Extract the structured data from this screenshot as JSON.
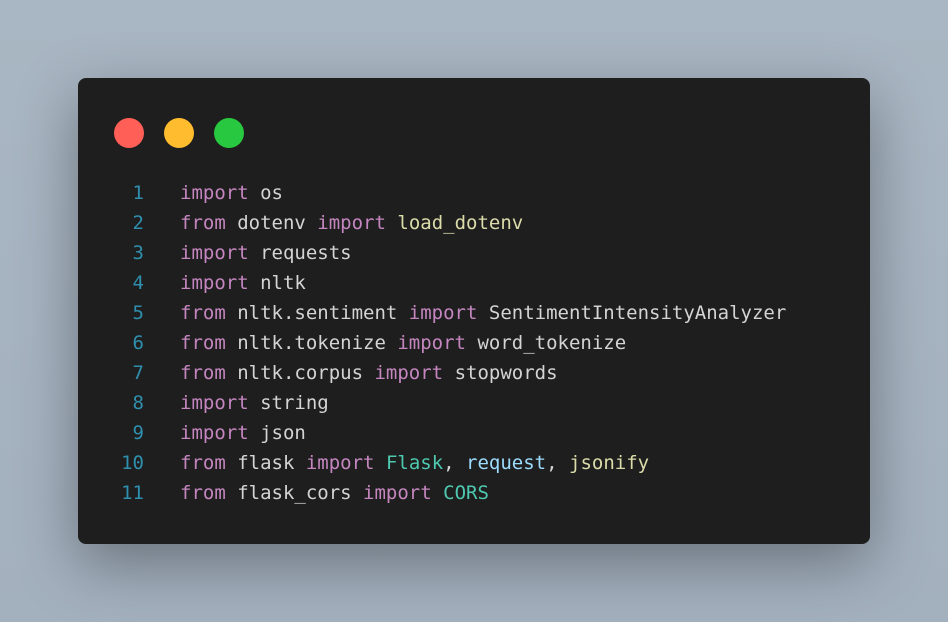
{
  "colors": {
    "dot_red": "#ff5f57",
    "dot_yellow": "#febc2e",
    "dot_green": "#28c840",
    "keyword": "#c586c0",
    "function": "#dcdcaa",
    "class": "#4ec9b0",
    "variable": "#9cdcfe",
    "text": "#d4d4d4",
    "line_number": "#2f8fae",
    "editor_bg": "#1e1e1e"
  },
  "window_controls": [
    "close-dot",
    "minimize-dot",
    "maximize-dot"
  ],
  "code": {
    "lines": [
      {
        "num": "1",
        "tokens": [
          {
            "t": "import",
            "c": "kw"
          },
          {
            "t": " os",
            "c": "plain"
          }
        ]
      },
      {
        "num": "2",
        "tokens": [
          {
            "t": "from",
            "c": "kw"
          },
          {
            "t": " dotenv ",
            "c": "plain"
          },
          {
            "t": "import",
            "c": "kw"
          },
          {
            "t": " ",
            "c": "plain"
          },
          {
            "t": "load_dotenv",
            "c": "fn"
          }
        ]
      },
      {
        "num": "3",
        "tokens": [
          {
            "t": "import",
            "c": "kw"
          },
          {
            "t": " requests",
            "c": "plain"
          }
        ]
      },
      {
        "num": "4",
        "tokens": [
          {
            "t": "import",
            "c": "kw"
          },
          {
            "t": " nltk",
            "c": "plain"
          }
        ]
      },
      {
        "num": "5",
        "tokens": [
          {
            "t": "from",
            "c": "kw"
          },
          {
            "t": " nltk.sentiment ",
            "c": "plain"
          },
          {
            "t": "import",
            "c": "kw"
          },
          {
            "t": " SentimentIntensityAnalyzer",
            "c": "plain"
          }
        ]
      },
      {
        "num": "6",
        "tokens": [
          {
            "t": "from",
            "c": "kw"
          },
          {
            "t": " nltk.tokenize ",
            "c": "plain"
          },
          {
            "t": "import",
            "c": "kw"
          },
          {
            "t": " word_tokenize",
            "c": "plain"
          }
        ]
      },
      {
        "num": "7",
        "tokens": [
          {
            "t": "from",
            "c": "kw"
          },
          {
            "t": " nltk.corpus ",
            "c": "plain"
          },
          {
            "t": "import",
            "c": "kw"
          },
          {
            "t": " stopwords",
            "c": "plain"
          }
        ]
      },
      {
        "num": "8",
        "tokens": [
          {
            "t": "import",
            "c": "kw"
          },
          {
            "t": " string",
            "c": "plain"
          }
        ]
      },
      {
        "num": "9",
        "tokens": [
          {
            "t": "import",
            "c": "kw"
          },
          {
            "t": " json",
            "c": "plain"
          }
        ]
      },
      {
        "num": "10",
        "tokens": [
          {
            "t": "from",
            "c": "kw"
          },
          {
            "t": " flask ",
            "c": "plain"
          },
          {
            "t": "import",
            "c": "kw"
          },
          {
            "t": " ",
            "c": "plain"
          },
          {
            "t": "Flask",
            "c": "cls"
          },
          {
            "t": ", ",
            "c": "plain"
          },
          {
            "t": "request",
            "c": "var"
          },
          {
            "t": ", ",
            "c": "plain"
          },
          {
            "t": "jsonify",
            "c": "fn"
          }
        ]
      },
      {
        "num": "11",
        "tokens": [
          {
            "t": "from",
            "c": "kw"
          },
          {
            "t": " flask_cors ",
            "c": "plain"
          },
          {
            "t": "import",
            "c": "kw"
          },
          {
            "t": " ",
            "c": "plain"
          },
          {
            "t": "CORS",
            "c": "cls"
          }
        ]
      }
    ]
  }
}
